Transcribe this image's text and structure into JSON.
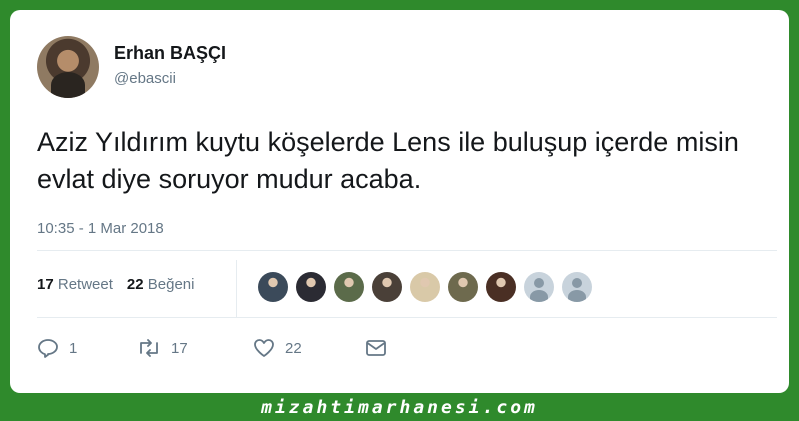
{
  "tweet": {
    "author": {
      "display_name": "Erhan BAŞÇI",
      "handle": "@ebascii"
    },
    "text": "Aziz Yıldırım kuytu köşelerde Lens ile buluşup içerde misin evlat diye soruyor mudur acaba.",
    "timestamp": "10:35 - 1 Mar 2018",
    "stats": {
      "retweets": {
        "count": "17",
        "label": "Retweet"
      },
      "likes": {
        "count": "22",
        "label": "Beğeni"
      }
    },
    "likers": [
      {
        "name": "liker-1",
        "color": "#3b4a5a"
      },
      {
        "name": "liker-2",
        "color": "#2b2b33"
      },
      {
        "name": "liker-3",
        "color": "#5b6b4a"
      },
      {
        "name": "liker-4",
        "color": "#4a4038"
      },
      {
        "name": "liker-5",
        "color": "#d9c9a8"
      },
      {
        "name": "liker-6",
        "color": "#6e6a4e"
      },
      {
        "name": "liker-7",
        "color": "#4a2f24"
      },
      {
        "name": "liker-8",
        "color": "default"
      },
      {
        "name": "liker-9",
        "color": "default"
      }
    ],
    "actions": {
      "reply": {
        "icon": "reply-icon",
        "count": "1"
      },
      "retweet": {
        "icon": "retweet-icon",
        "count": "17"
      },
      "like": {
        "icon": "heart-icon",
        "count": "22"
      },
      "message": {
        "icon": "envelope-icon"
      }
    }
  },
  "footer": {
    "watermark": "mizahtimarhanesi.com"
  },
  "colors": {
    "frame": "#2f8a2c",
    "card": "#ffffff",
    "text": "#14171a",
    "muted": "#657786"
  }
}
